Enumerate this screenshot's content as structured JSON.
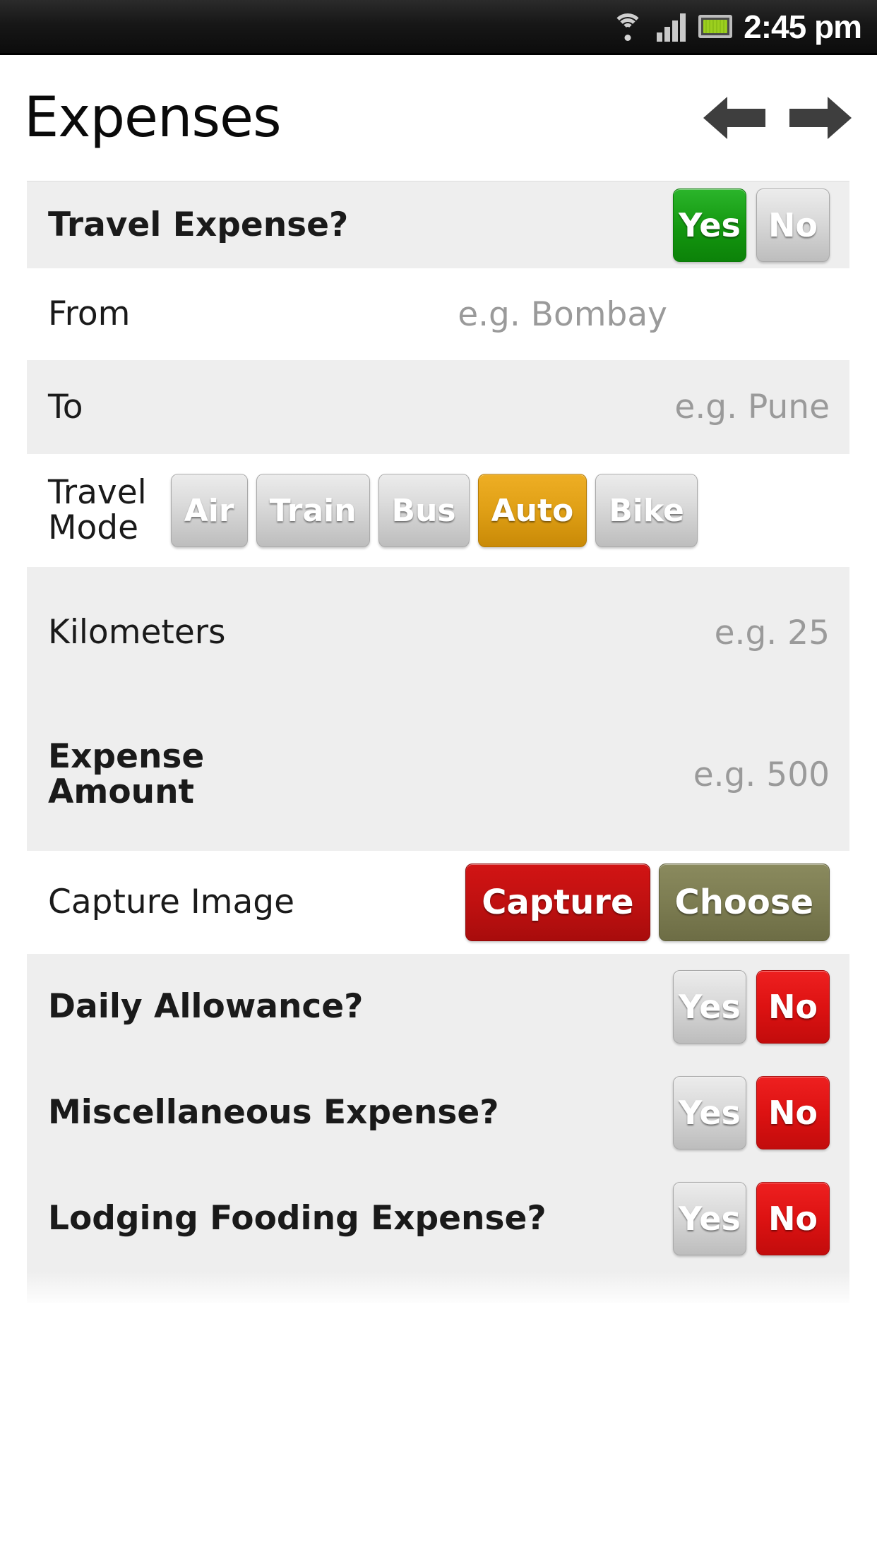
{
  "statusbar": {
    "time": "2:45 pm",
    "icons": [
      "wifi-icon",
      "signal-icon",
      "battery-icon"
    ]
  },
  "header": {
    "title": "Expenses",
    "prev_label": "back-arrow",
    "next_label": "forward-arrow"
  },
  "form": {
    "travel_expense": {
      "label": "Travel Expense?",
      "yes": "Yes",
      "no": "No",
      "selected": "Yes"
    },
    "from": {
      "label": "From",
      "placeholder": "e.g. Bombay",
      "value": ""
    },
    "to": {
      "label": "To",
      "placeholder": "e.g. Pune",
      "value": ""
    },
    "travel_mode": {
      "label": "Travel\nMode",
      "label_line1": "Travel",
      "label_line2": "Mode",
      "options": [
        "Air",
        "Train",
        "Bus",
        "Auto",
        "Bike"
      ],
      "selected": "Auto"
    },
    "kilometers": {
      "label": "Kilometers",
      "placeholder": "e.g. 25",
      "value": ""
    },
    "expense_amount": {
      "label_line1": "Expense",
      "label_line2": "Amount",
      "placeholder": "e.g. 500",
      "value": ""
    },
    "capture_image": {
      "label": "Capture Image",
      "capture": "Capture",
      "choose": "Choose"
    },
    "daily_allowance": {
      "label": "Daily Allowance?",
      "yes": "Yes",
      "no": "No",
      "selected": "No"
    },
    "misc_expense": {
      "label": "Miscellaneous Expense?",
      "yes": "Yes",
      "no": "No",
      "selected": "No"
    },
    "lodging_fooding": {
      "label": "Lodging Fooding Expense?",
      "yes": "Yes",
      "no": "No",
      "selected": "No"
    }
  },
  "colors": {
    "selected_yes": "#13960f",
    "selected_no": "#dd1212",
    "selected_mode": "#e0a016",
    "capture": "#c21111",
    "choose": "#7d7d52",
    "row_gray": "#eeeeee",
    "row_white": "#ffffff",
    "arrow": "#3e3e3e"
  }
}
